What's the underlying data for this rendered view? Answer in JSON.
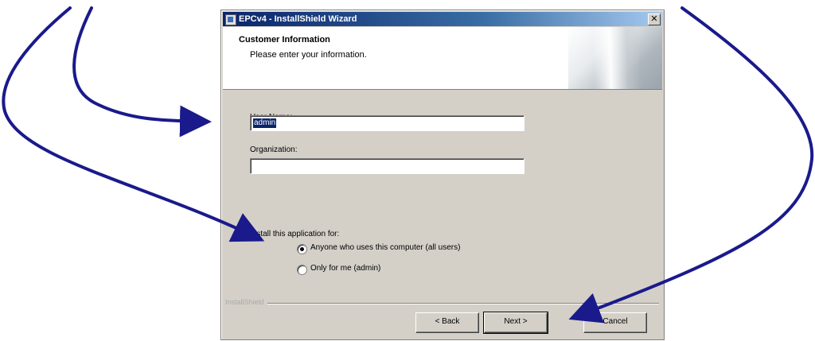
{
  "window": {
    "title": "EPCv4 - InstallShield Wizard",
    "close_glyph": "✕"
  },
  "banner": {
    "title": "Customer Information",
    "subtitle": "Please enter your information."
  },
  "form": {
    "user_name_label": "User Name:",
    "user_name_value": "admin",
    "organization_label": "Organization:",
    "organization_value": "",
    "install_for_label": "Install this application for:",
    "options": [
      {
        "label": "Anyone who uses this computer (all users)",
        "checked": true
      },
      {
        "label": "Only for me (admin)",
        "checked": false
      }
    ]
  },
  "footer": {
    "brand": "InstallShield",
    "back_label": "< Back",
    "next_label": "Next >",
    "cancel_label": "Cancel"
  },
  "annotation": {
    "arrow_color": "#1a1a8c"
  }
}
